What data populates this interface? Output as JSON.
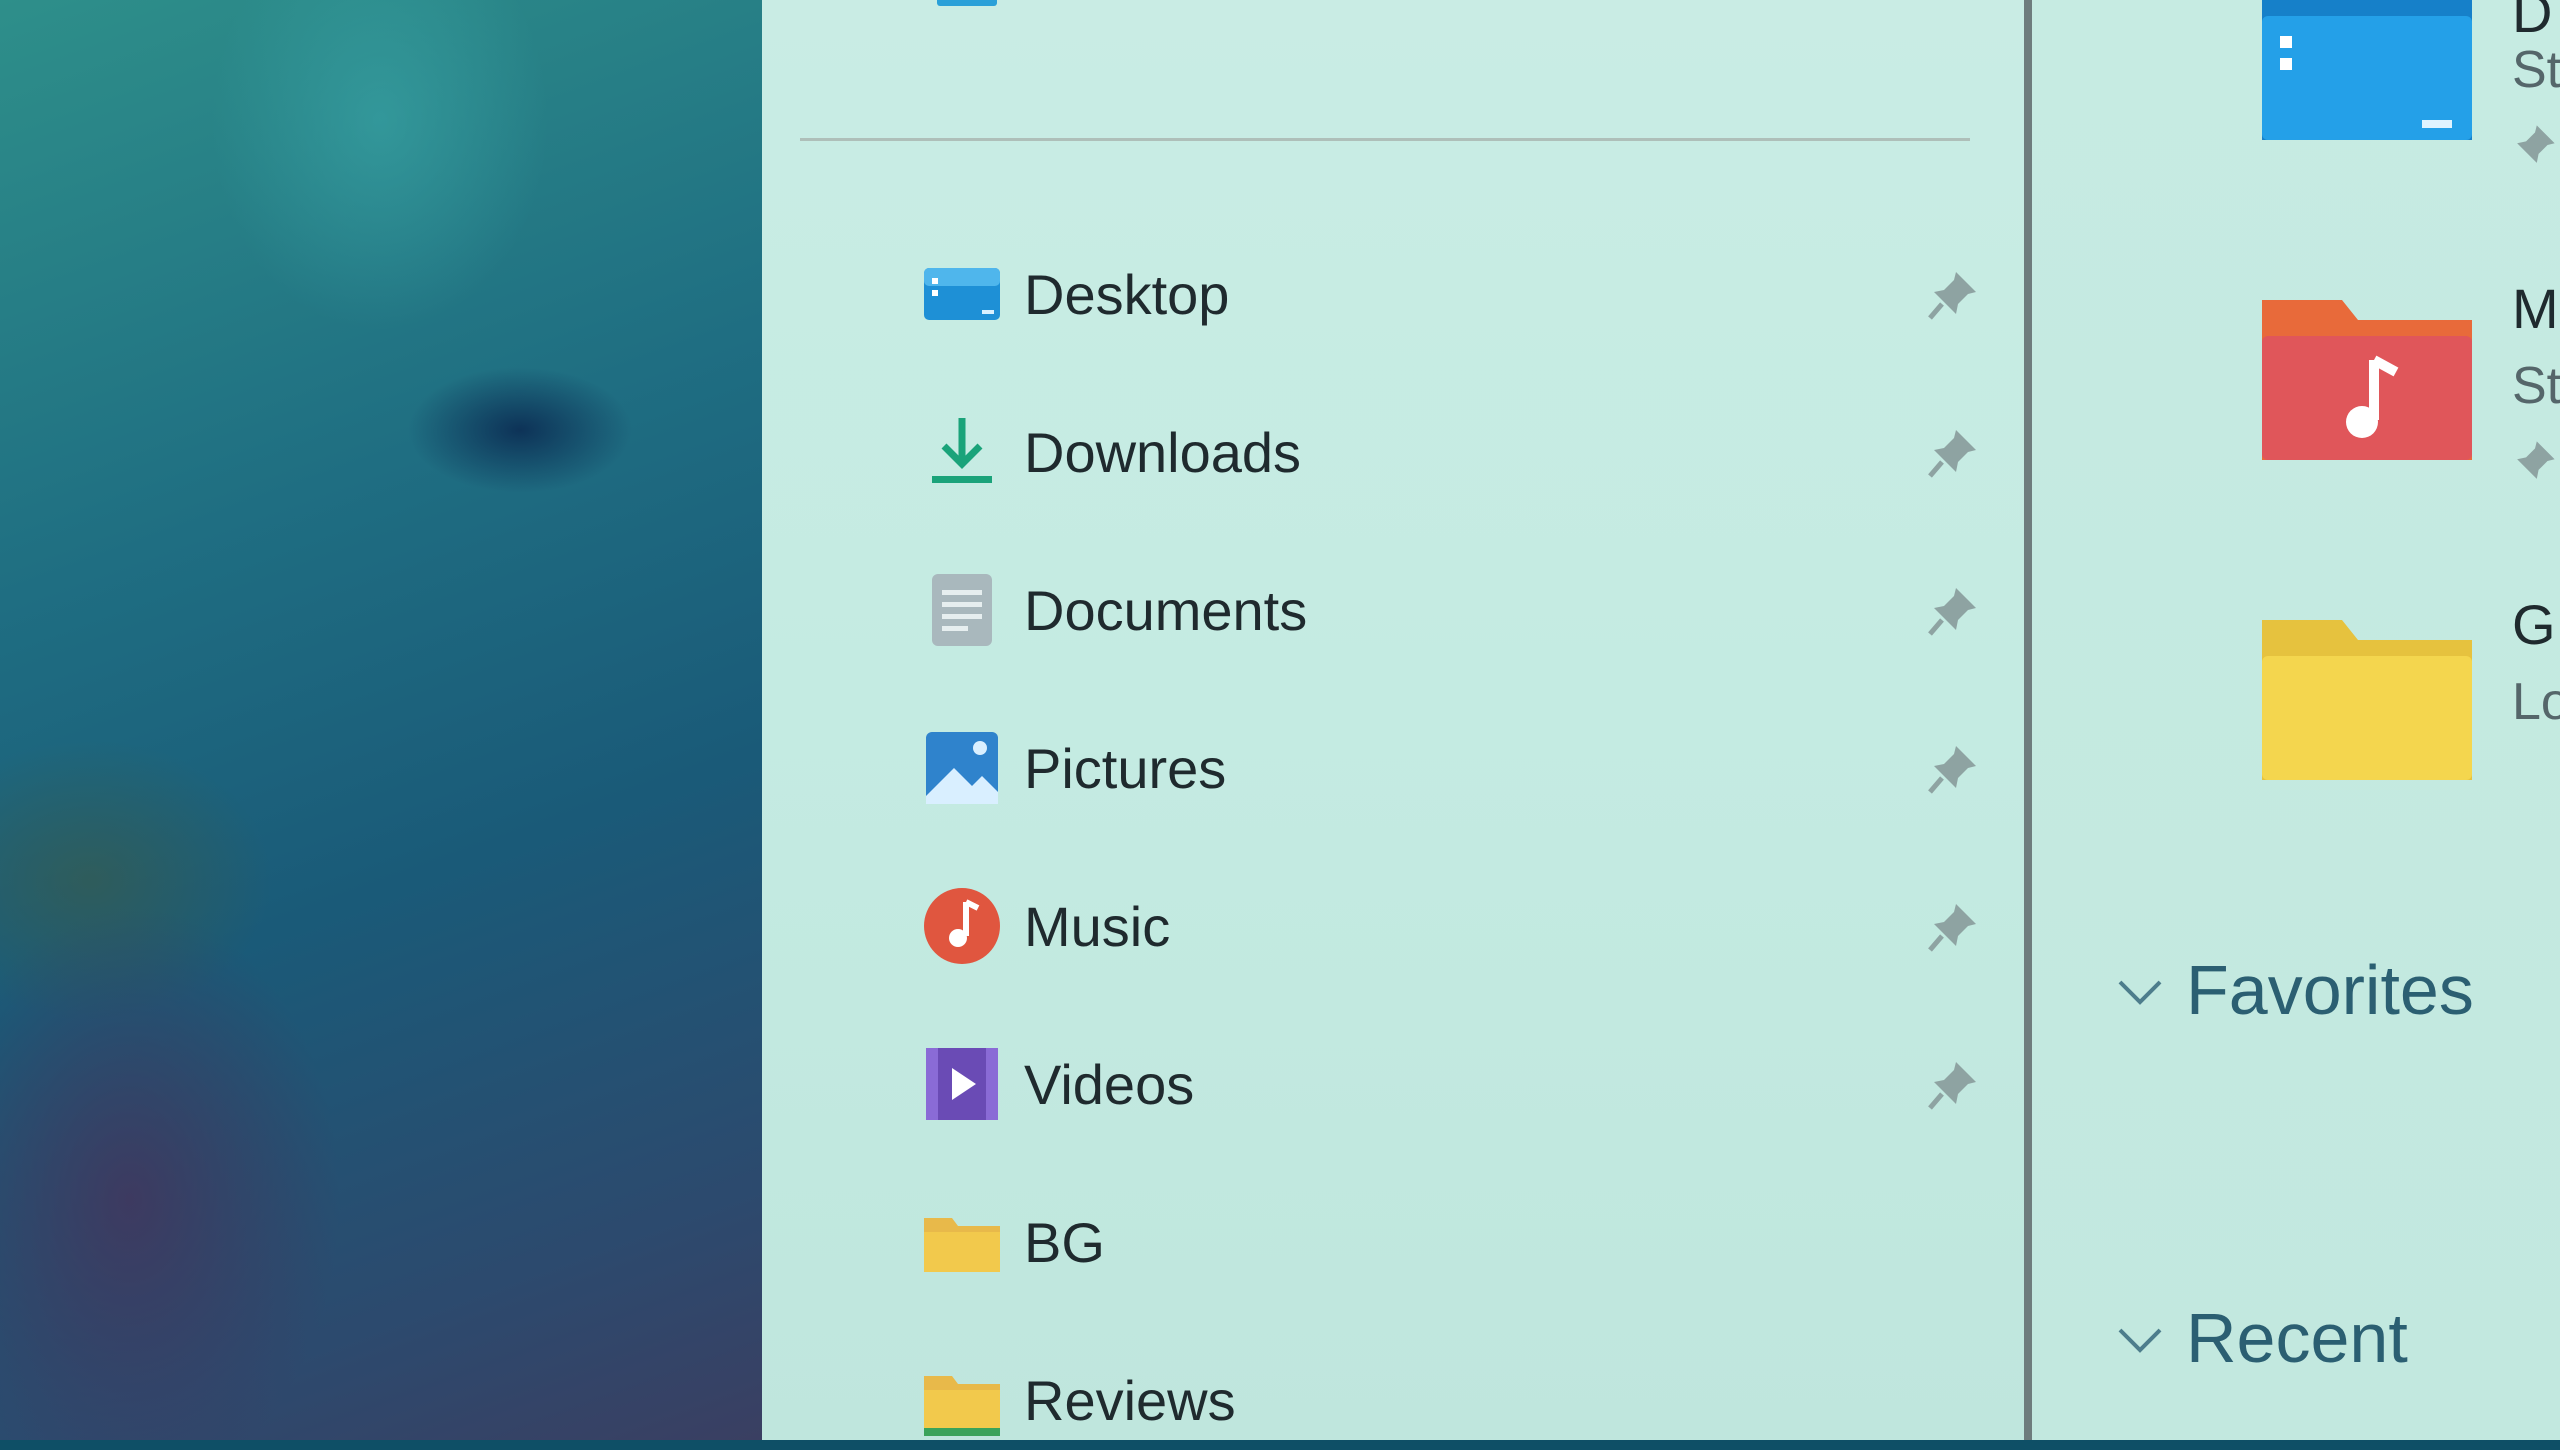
{
  "nav": {
    "items": [
      {
        "label": "Desktop",
        "icon": "desktop-icon",
        "pinned": true
      },
      {
        "label": "Downloads",
        "icon": "downloads-icon",
        "pinned": true
      },
      {
        "label": "Documents",
        "icon": "documents-icon",
        "pinned": true
      },
      {
        "label": "Pictures",
        "icon": "pictures-icon",
        "pinned": true
      },
      {
        "label": "Music",
        "icon": "music-icon",
        "pinned": true
      },
      {
        "label": "Videos",
        "icon": "videos-icon",
        "pinned": true
      },
      {
        "label": "BG",
        "icon": "folder-icon",
        "pinned": false
      },
      {
        "label": "Reviews",
        "icon": "folder-icon",
        "pinned": false
      }
    ]
  },
  "content": {
    "tiles": [
      {
        "name": "D",
        "sub": "St",
        "icon": "desktop-folder-icon"
      },
      {
        "name": "M",
        "sub": "St",
        "icon": "music-folder-icon"
      },
      {
        "name": "G",
        "sub": "Lo",
        "icon": "folder-icon"
      }
    ],
    "sections": {
      "favorites": "Favorites",
      "recent": "Recent"
    }
  },
  "colors": {
    "accent": "#2b5f72",
    "folder_yellow": "#f2c94c",
    "music_red": "#e0563f",
    "video_purple": "#6a4bb5",
    "desktop_blue": "#1e90d6"
  }
}
